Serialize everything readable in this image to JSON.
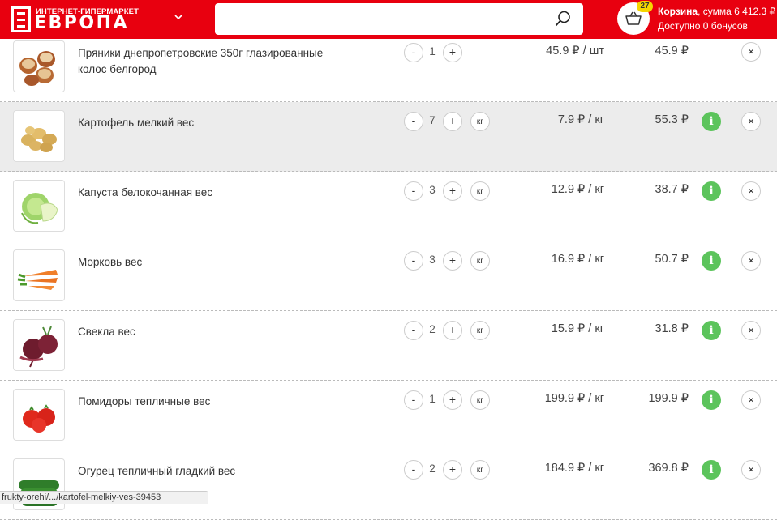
{
  "header": {
    "logo_top": "ИНТЕРНЕТ-ГИПЕРМАРКЕТ",
    "logo_main": "ЕВРОПА",
    "search": {
      "value": "",
      "placeholder": ""
    },
    "cart": {
      "badge": "27",
      "label": "Корзина",
      "sum_text": ", сумма 6 412.3 ₽",
      "bonus_text": "Доступно 0 бонусов"
    }
  },
  "colors": {
    "header_bg": "#e8000f",
    "info_green": "#5cc45c",
    "badge_yellow": "#f5d600"
  },
  "items": [
    {
      "name": "Пряники днепропетровские 350г глазированные колос белгород",
      "qty": "1",
      "unit": "",
      "unit_price": "45.9 ₽ / шт",
      "total": "45.9 ₽",
      "has_info": false,
      "image": "gingerbread"
    },
    {
      "name": "Картофель мелкий вес",
      "qty": "7",
      "unit": "кг",
      "unit_price": "7.9 ₽ / кг",
      "total": "55.3 ₽",
      "has_info": true,
      "image": "potato"
    },
    {
      "name": "Капуста белокочанная вес",
      "qty": "3",
      "unit": "кг",
      "unit_price": "12.9 ₽ / кг",
      "total": "38.7 ₽",
      "has_info": true,
      "image": "cabbage"
    },
    {
      "name": "Морковь вес",
      "qty": "3",
      "unit": "кг",
      "unit_price": "16.9 ₽ / кг",
      "total": "50.7 ₽",
      "has_info": true,
      "image": "carrot"
    },
    {
      "name": "Свекла вес",
      "qty": "2",
      "unit": "кг",
      "unit_price": "15.9 ₽ / кг",
      "total": "31.8 ₽",
      "has_info": true,
      "image": "beet"
    },
    {
      "name": "Помидоры тепличные вес",
      "qty": "1",
      "unit": "кг",
      "unit_price": "199.9 ₽ / кг",
      "total": "199.9 ₽",
      "has_info": true,
      "image": "tomato"
    },
    {
      "name": "Огурец тепличный гладкий вес",
      "qty": "2",
      "unit": "кг",
      "unit_price": "184.9 ₽ / кг",
      "total": "369.8 ₽",
      "has_info": true,
      "image": "cucumber"
    }
  ],
  "controls": {
    "minus": "-",
    "plus": "+",
    "info": "i",
    "remove": "×"
  },
  "status_url": "frukty-orehi/.../kartofel-melkiy-ves-39453"
}
